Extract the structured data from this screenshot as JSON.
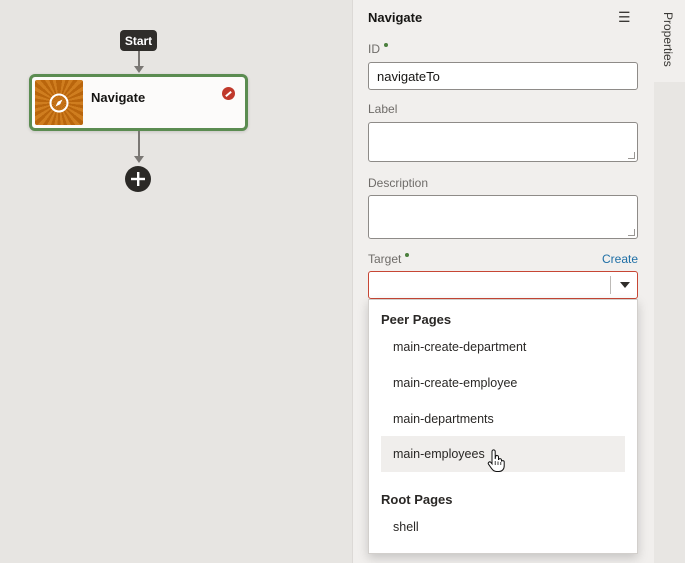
{
  "canvas": {
    "start_label": "Start",
    "node": {
      "label": "Navigate",
      "icon": "compass-icon",
      "status": "error"
    }
  },
  "panel": {
    "title": "Navigate",
    "fields": {
      "id": {
        "label": "ID",
        "value": "navigateTo"
      },
      "label": {
        "label": "Label",
        "value": ""
      },
      "description": {
        "label": "Description",
        "value": ""
      },
      "target": {
        "label": "Target",
        "value": "",
        "create_label": "Create"
      }
    },
    "dropdown": {
      "groups": [
        {
          "header": "Peer Pages",
          "options": [
            "main-create-department",
            "main-create-employee",
            "main-departments",
            "main-employees"
          ]
        },
        {
          "header": "Root Pages",
          "options": [
            "shell"
          ]
        }
      ],
      "hovered": "main-employees"
    }
  },
  "side_tab": {
    "label": "Properties"
  },
  "colors": {
    "accent_green": "#5b8c51",
    "error_red": "#c74634",
    "link_blue": "#1f6fa6"
  }
}
